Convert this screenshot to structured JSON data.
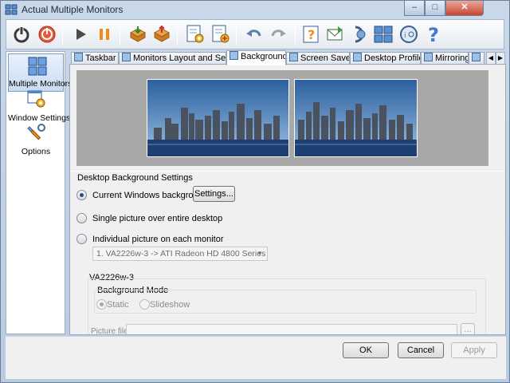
{
  "window": {
    "title": "Actual Multiple Monitors",
    "controls": {
      "minimize": "–",
      "maximize": "□",
      "close": "✕"
    }
  },
  "toolbar": {
    "buttons": [
      "power-icon",
      "stop-icon",
      "play-icon",
      "pause-icon",
      "import-icon",
      "export-icon",
      "settings-save-icon",
      "settings-load-icon",
      "undo-icon",
      "redo-icon",
      "help-question-icon",
      "email-icon",
      "support-icon",
      "layout-icon",
      "about-icon",
      "help-icon"
    ]
  },
  "sidebar": {
    "items": [
      {
        "label": "Multiple Monitors",
        "icon": "monitors-icon",
        "selected": true
      },
      {
        "label": "Window Settings",
        "icon": "window-settings-icon",
        "selected": false
      },
      {
        "label": "Options",
        "icon": "options-icon",
        "selected": false
      }
    ]
  },
  "tabs": [
    {
      "label": "Taskbar",
      "active": false
    },
    {
      "label": "Monitors Layout and Settings",
      "active": false
    },
    {
      "label": "Background",
      "active": true
    },
    {
      "label": "Screen Saver",
      "active": false
    },
    {
      "label": "Desktop Profiles",
      "active": false
    },
    {
      "label": "Mirroring",
      "active": false
    }
  ],
  "background": {
    "group_title": "Desktop Background Settings",
    "options": [
      {
        "label": "Current Windows background",
        "checked": true
      },
      {
        "label": "Single picture over entire desktop",
        "checked": false
      },
      {
        "label": "Individual picture on each monitor",
        "checked": false
      }
    ],
    "settings_button": "Settings...",
    "monitor_select": "1. VA2226w-3 -> ATI Radeon HD 4800 Series",
    "monitor_group": "VA2226w-3",
    "mode_group": "Background Mode",
    "mode_static": "Static",
    "mode_slideshow": "Slideshow",
    "picture_file_label": "Picture file:",
    "browse_button": "..."
  },
  "dialog": {
    "ok": "OK",
    "cancel": "Cancel",
    "apply": "Apply"
  },
  "colors": {
    "accent": "#1d4f91",
    "title_bg": "#c9d9ea",
    "close_red": "#c8452f",
    "preview_gray": "#a8a8a8"
  }
}
